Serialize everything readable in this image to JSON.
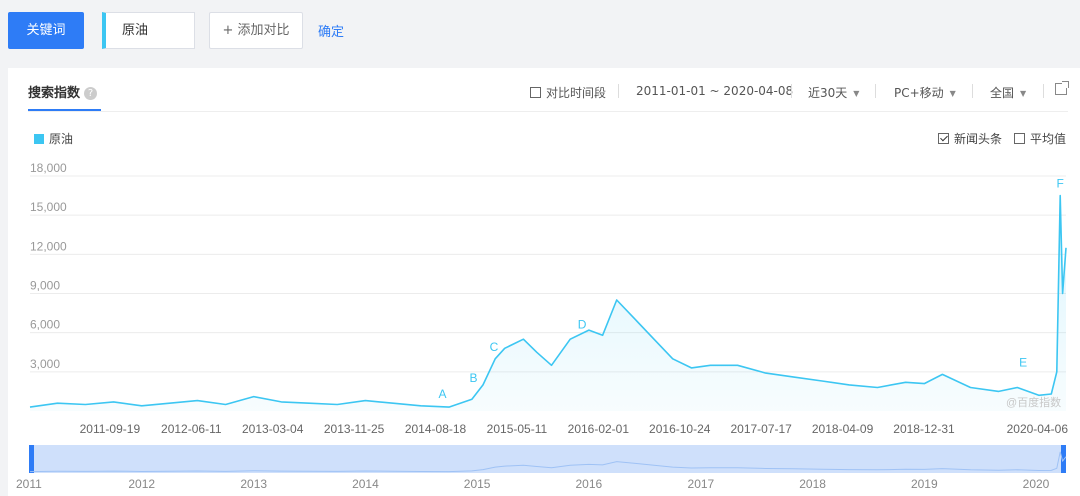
{
  "top": {
    "keyword_button": "关键词",
    "keyword_value": "原油",
    "add_compare": "+ 添加对比",
    "confirm": "确定"
  },
  "panel": {
    "tab_label": "搜索指数",
    "compare_period": "对比时间段",
    "date_range": "2011-01-01 ~ 2020-04-08",
    "period": "近30天",
    "device": "PC+移动",
    "region": "全国",
    "legend": "原油",
    "news_headlines": "新闻头条",
    "average": "平均值",
    "watermark": "@百度指数"
  },
  "chart_data": {
    "type": "area",
    "y_ticks": [
      "18,000",
      "15,000",
      "12,000",
      "9,000",
      "6,000",
      "3,000"
    ],
    "y_tick_values": [
      18000,
      15000,
      12000,
      9000,
      6000,
      3000
    ],
    "ylim": [
      0,
      18000
    ],
    "x_tick_labels": [
      "2011-09-19",
      "2012-06-11",
      "2013-03-04",
      "2013-11-25",
      "2014-08-18",
      "2015-05-11",
      "2016-02-01",
      "2016-10-24",
      "2017-07-17",
      "2018-04-09",
      "2018-12-31",
      "2020-04-06"
    ],
    "x_tick_dates": [
      "2011-09-19",
      "2012-06-11",
      "2013-03-04",
      "2013-11-25",
      "2014-08-18",
      "2015-05-11",
      "2016-02-01",
      "2016-10-24",
      "2017-07-17",
      "2018-04-09",
      "2018-12-31",
      "2020-04-06"
    ],
    "overview_years": [
      "2011",
      "2012",
      "2013",
      "2014",
      "2015",
      "2016",
      "2017",
      "2018",
      "2019",
      "2020"
    ],
    "xlim": [
      "2011-01-01",
      "2020-04-08"
    ],
    "grid": true,
    "color": "#3cc6f2",
    "series": [
      {
        "name": "原油",
        "x": [
          "2011-01-01",
          "2011-04-01",
          "2011-07-01",
          "2011-10-01",
          "2012-01-01",
          "2012-04-01",
          "2012-07-01",
          "2012-10-01",
          "2013-01-01",
          "2013-04-01",
          "2013-07-01",
          "2013-10-01",
          "2014-01-01",
          "2014-04-01",
          "2014-07-01",
          "2014-10-01",
          "2014-12-15",
          "2015-01-20",
          "2015-03-01",
          "2015-04-01",
          "2015-06-01",
          "2015-07-15",
          "2015-09-01",
          "2015-11-01",
          "2016-01-01",
          "2016-02-15",
          "2016-04-01",
          "2016-06-01",
          "2016-08-01",
          "2016-10-01",
          "2016-12-01",
          "2017-02-01",
          "2017-05-01",
          "2017-08-01",
          "2017-11-01",
          "2018-02-01",
          "2018-05-01",
          "2018-08-01",
          "2018-11-01",
          "2019-01-01",
          "2019-03-01",
          "2019-06-01",
          "2019-09-01",
          "2019-11-01",
          "2020-01-10",
          "2020-02-20",
          "2020-03-09",
          "2020-03-20",
          "2020-03-28",
          "2020-04-08"
        ],
        "values": [
          300,
          600,
          500,
          700,
          400,
          600,
          800,
          500,
          1100,
          700,
          600,
          500,
          800,
          600,
          400,
          300,
          900,
          2000,
          4000,
          4800,
          5500,
          4500,
          3500,
          5500,
          6200,
          5800,
          8500,
          7000,
          5500,
          4000,
          3300,
          3500,
          3500,
          2900,
          2600,
          2300,
          2000,
          1800,
          2200,
          2100,
          2800,
          1800,
          1500,
          1800,
          1200,
          1300,
          3000,
          16500,
          9000,
          12500
        ]
      }
    ],
    "annotations": [
      {
        "label": "A",
        "date": "2014-09-10",
        "value": 400
      },
      {
        "label": "B",
        "date": "2014-12-20",
        "value": 1600
      },
      {
        "label": "C",
        "date": "2015-02-25",
        "value": 4000
      },
      {
        "label": "D",
        "date": "2015-12-10",
        "value": 5700
      },
      {
        "label": "E",
        "date": "2019-11-20",
        "value": 2800
      },
      {
        "label": "F",
        "date": "2020-03-20",
        "value": 16500
      }
    ]
  }
}
